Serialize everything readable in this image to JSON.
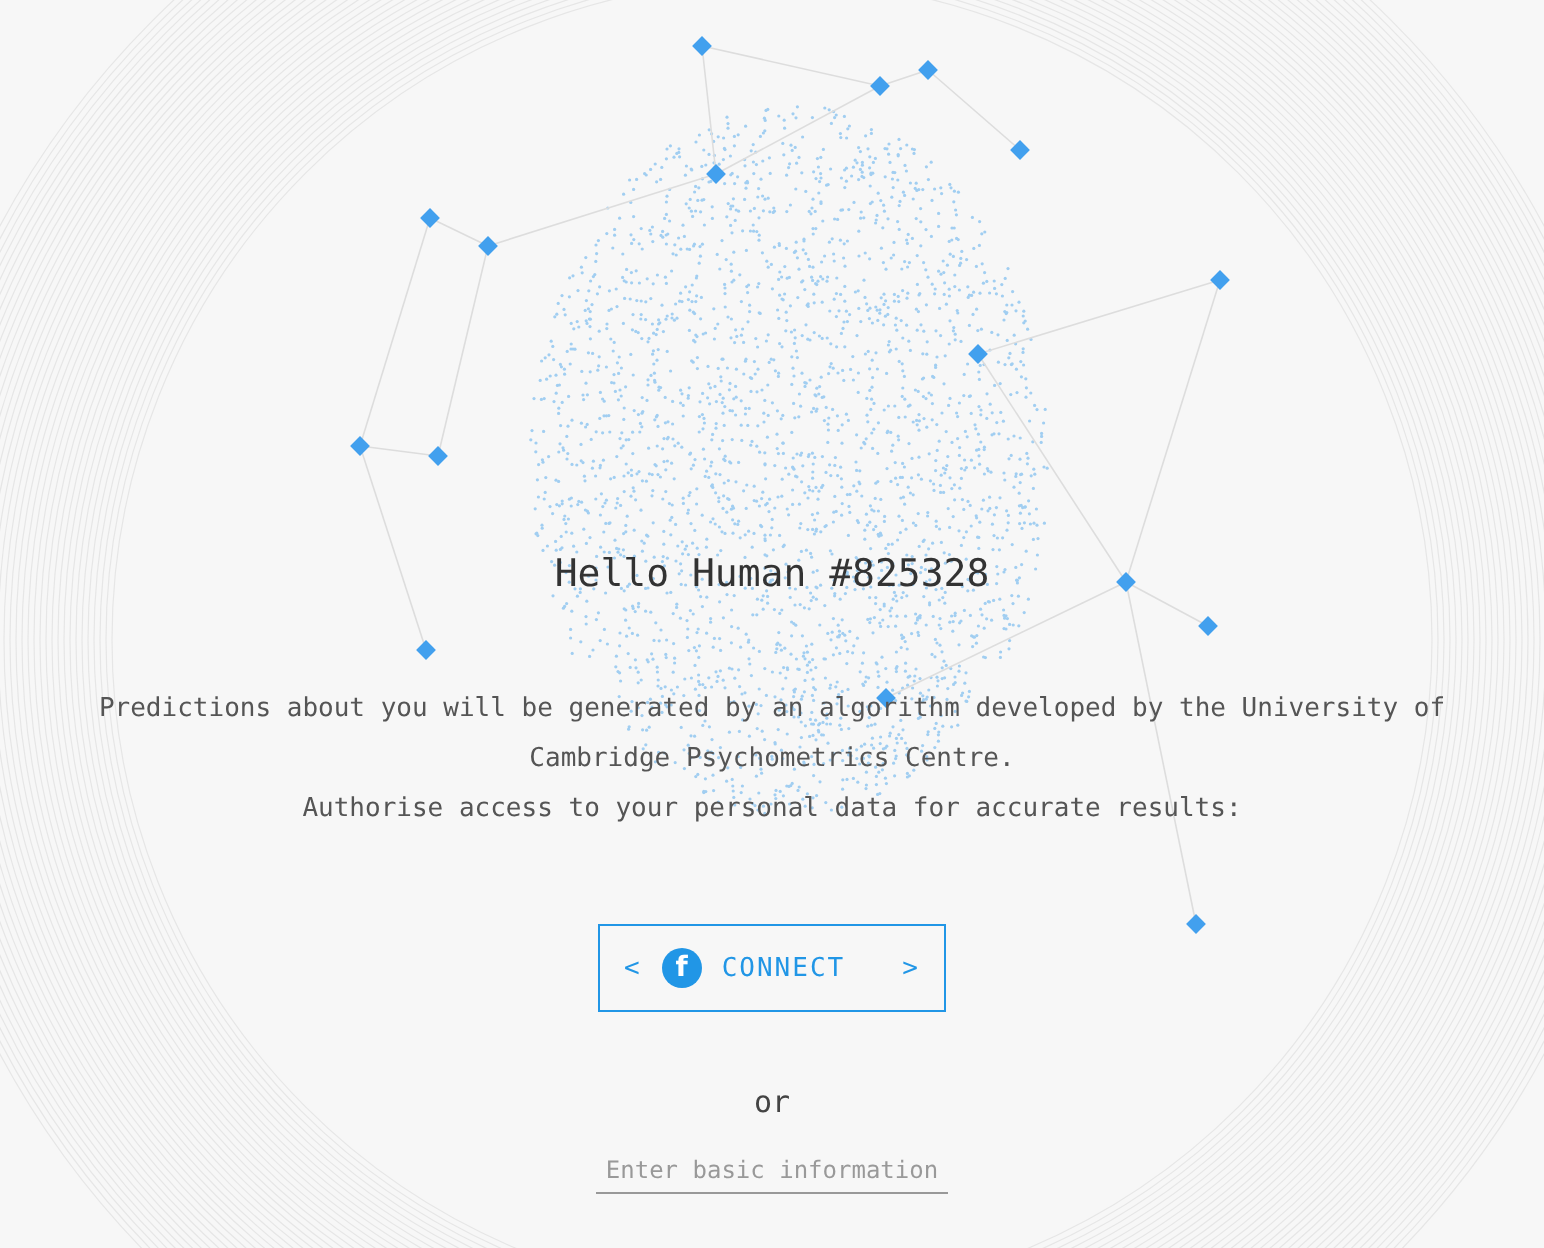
{
  "title": "Hello Human #825328",
  "intro": [
    "Predictions about you will be generated by an algorithm developed by the University of Cambridge Psychometrics Centre.",
    "Authorise access to your personal data for accurate results:"
  ],
  "connect_button": {
    "prev": "<",
    "icon": "f",
    "label": "CONNECT",
    "next": ">"
  },
  "separator": "or",
  "info_field": {
    "placeholder": "Enter basic information"
  }
}
